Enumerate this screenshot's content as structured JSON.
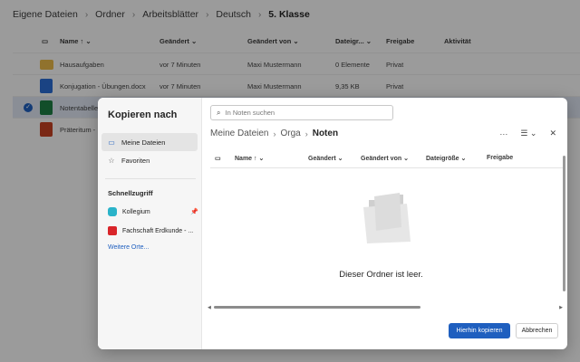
{
  "breadcrumb": [
    "Eigene Dateien",
    "Ordner",
    "Arbeitsblätter",
    "Deutsch",
    "5. Klasse"
  ],
  "list": {
    "headers": {
      "name": "Name",
      "modified": "Geändert",
      "modified_by": "Geändert von",
      "size": "Dateigr...",
      "sharing": "Freigabe",
      "activity": "Aktivität"
    },
    "rows": [
      {
        "name": "Hausaufgaben",
        "modified": "vor 7 Minuten",
        "modified_by": "Maxi Mustermann",
        "size": "0 Elemente",
        "sharing": "Privat",
        "type": "folder"
      },
      {
        "name": "Konjugation - Übungen.docx",
        "modified": "vor 7 Minuten",
        "modified_by": "Maxi Mustermann",
        "size": "9,35 KB",
        "sharing": "Privat",
        "type": "docx"
      },
      {
        "name": "Notentabelle",
        "type": "xlsx",
        "selected": true
      },
      {
        "name": "Präteritum -",
        "type": "pptx"
      }
    ]
  },
  "dialog": {
    "title": "Kopieren nach",
    "nav": [
      {
        "label": "Meine Dateien",
        "active": true
      },
      {
        "label": "Favoriten"
      }
    ],
    "quick_access_title": "Schnellzugriff",
    "quick": [
      {
        "label": "Kollegium",
        "pinned": true
      },
      {
        "label": "Fachschaft Erdkunde - ..."
      }
    ],
    "more": "Weitere Orte...",
    "search_placeholder": "In Noten suchen",
    "crumbs": [
      "Meine Dateien",
      "Orga",
      "Noten"
    ],
    "columns": {
      "name": "Name",
      "modified": "Geändert",
      "modified_by": "Geändert von",
      "size": "Dateigröße",
      "sharing": "Freigabe"
    },
    "empty": "Dieser Ordner ist leer.",
    "copy_button": "Hierhin kopieren",
    "cancel_button": "Abbrechen"
  },
  "colors": {
    "accent": "#1f5fbf",
    "folder": "#e8b84a"
  }
}
